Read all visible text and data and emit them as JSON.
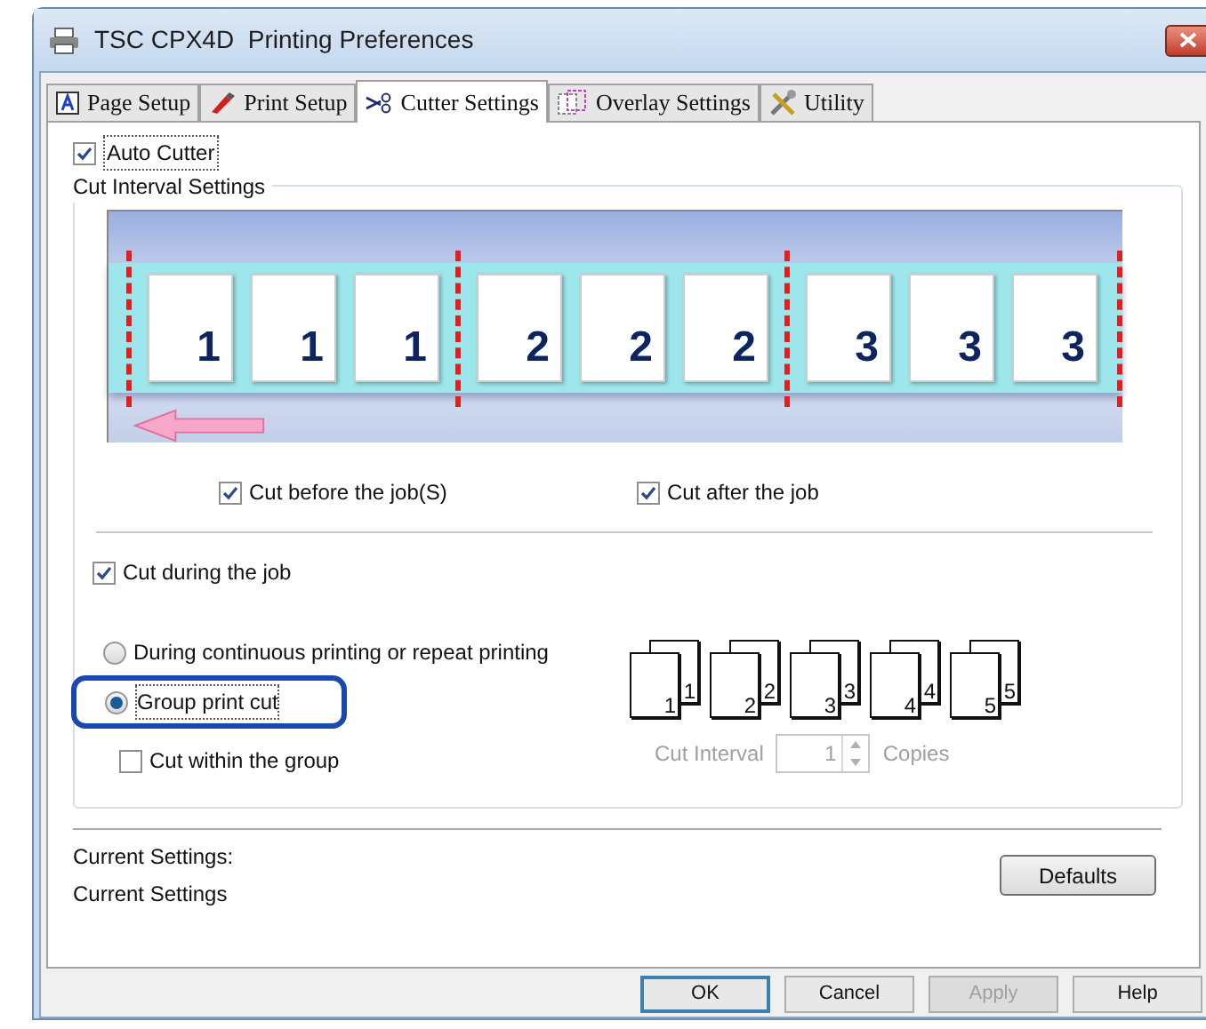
{
  "window": {
    "title": "TSC CPX4D  Printing Preferences"
  },
  "tabs": [
    {
      "label": "Page Setup",
      "selected": false
    },
    {
      "label": "Print Setup",
      "selected": false
    },
    {
      "label": "Cutter Settings",
      "selected": true
    },
    {
      "label": "Overlay Settings",
      "selected": false
    },
    {
      "label": "Utility",
      "selected": false
    }
  ],
  "auto_cutter": {
    "label": "Auto Cutter",
    "checked": true
  },
  "cut_interval": {
    "title": "Cut Interval Settings",
    "diagram_pages": [
      {
        "number": "1",
        "cut_before": true
      },
      {
        "number": "1",
        "cut_before": false
      },
      {
        "number": "1",
        "cut_before": false
      },
      {
        "number": "2",
        "cut_before": true
      },
      {
        "number": "2",
        "cut_before": false
      },
      {
        "number": "2",
        "cut_before": false
      },
      {
        "number": "3",
        "cut_before": true
      },
      {
        "number": "3",
        "cut_before": false
      },
      {
        "number": "3",
        "cut_before": false
      }
    ],
    "end_cut": true,
    "job_options": [
      {
        "label": "Cut before the job(S)",
        "checked": true
      },
      {
        "label": "Cut after the job",
        "checked": true
      }
    ],
    "cut_during": {
      "label": "Cut during the job",
      "checked": true
    },
    "modes": [
      {
        "label": "During continuous printing or repeat printing",
        "selected": false,
        "highlighted": false
      },
      {
        "label": "Group print cut",
        "selected": true,
        "highlighted": true
      }
    ],
    "cut_within": {
      "label": "Cut within the group",
      "checked": false
    },
    "stacks": [
      {
        "back": "1",
        "front": "1"
      },
      {
        "back": "2",
        "front": "2"
      },
      {
        "back": "3",
        "front": "3"
      },
      {
        "back": "4",
        "front": "4"
      },
      {
        "back": "5",
        "front": "5"
      }
    ],
    "interval": {
      "label": "Cut Interval",
      "value": "1",
      "unit": "Copies",
      "disabled": true
    }
  },
  "current": {
    "label": "Current Settings:",
    "value": "Current Settings"
  },
  "defaults_button": "Defaults",
  "buttons": [
    {
      "label": "OK",
      "default": true,
      "disabled": false
    },
    {
      "label": "Cancel",
      "default": false,
      "disabled": false
    },
    {
      "label": "Apply",
      "default": false,
      "disabled": true
    },
    {
      "label": "Help",
      "default": false,
      "disabled": false
    }
  ]
}
